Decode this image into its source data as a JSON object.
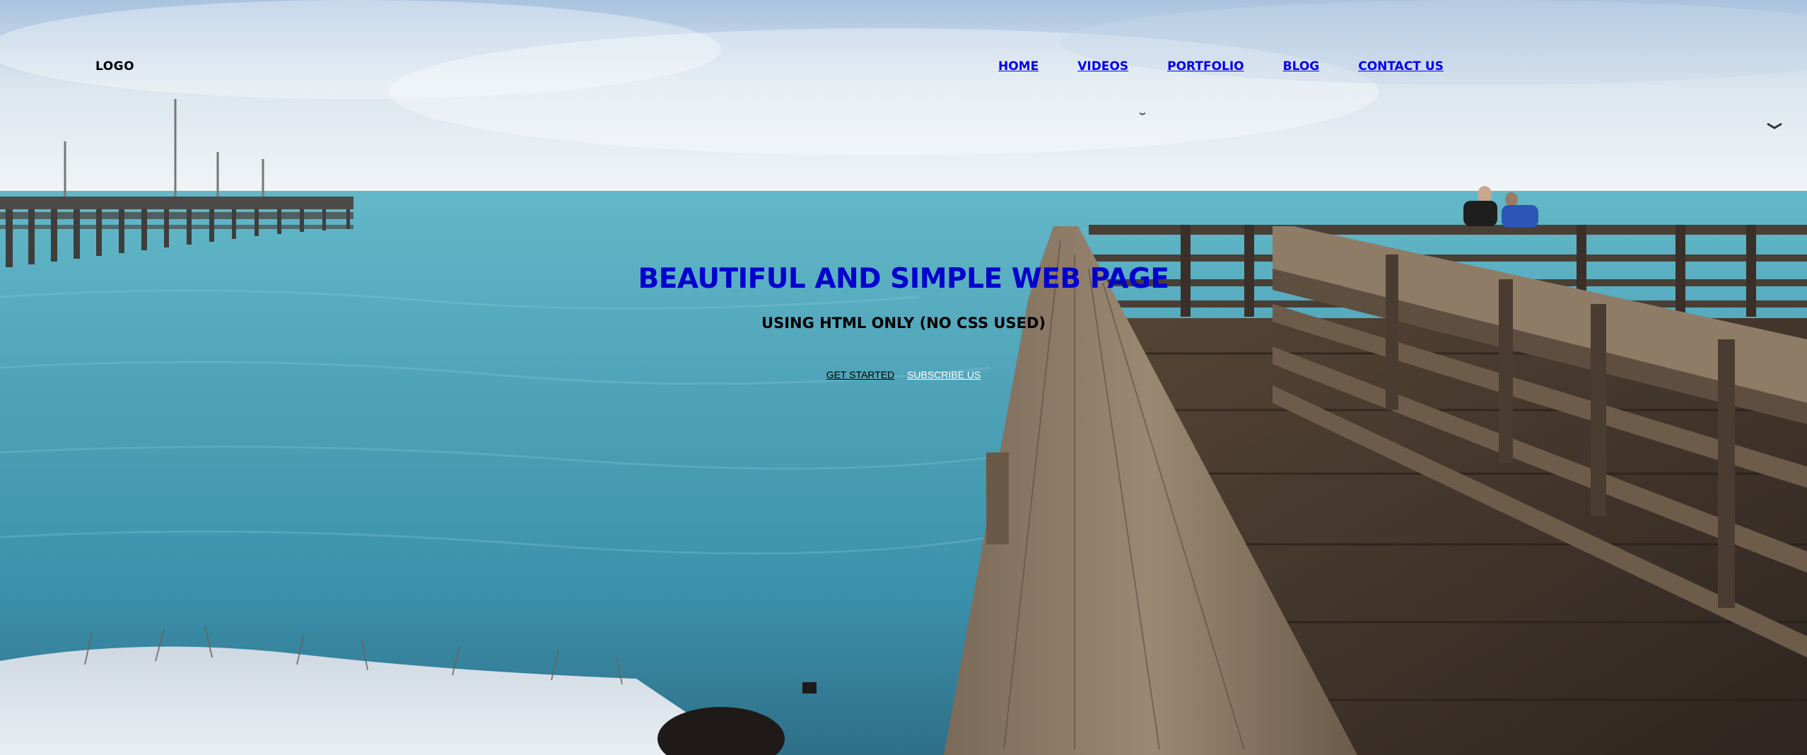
{
  "header": {
    "logo": "LOGO",
    "nav": [
      "HOME",
      "VIDEOS",
      "PORTFOLIO",
      "BLOG",
      "CONTACT US"
    ]
  },
  "hero": {
    "title": "BEAUTIFUL AND SIMPLE WEB PAGE",
    "subtitle": "USING HTML ONLY (NO CSS USED)",
    "cta_primary": "GET STARTED",
    "cta_secondary": "SUBSCRIBE US"
  },
  "colors": {
    "link": "#0000ee",
    "title": "#0000cd",
    "sky": "#dfe8f0",
    "sea": "#3b9fb7",
    "pier_wood": "#6e5a44"
  }
}
